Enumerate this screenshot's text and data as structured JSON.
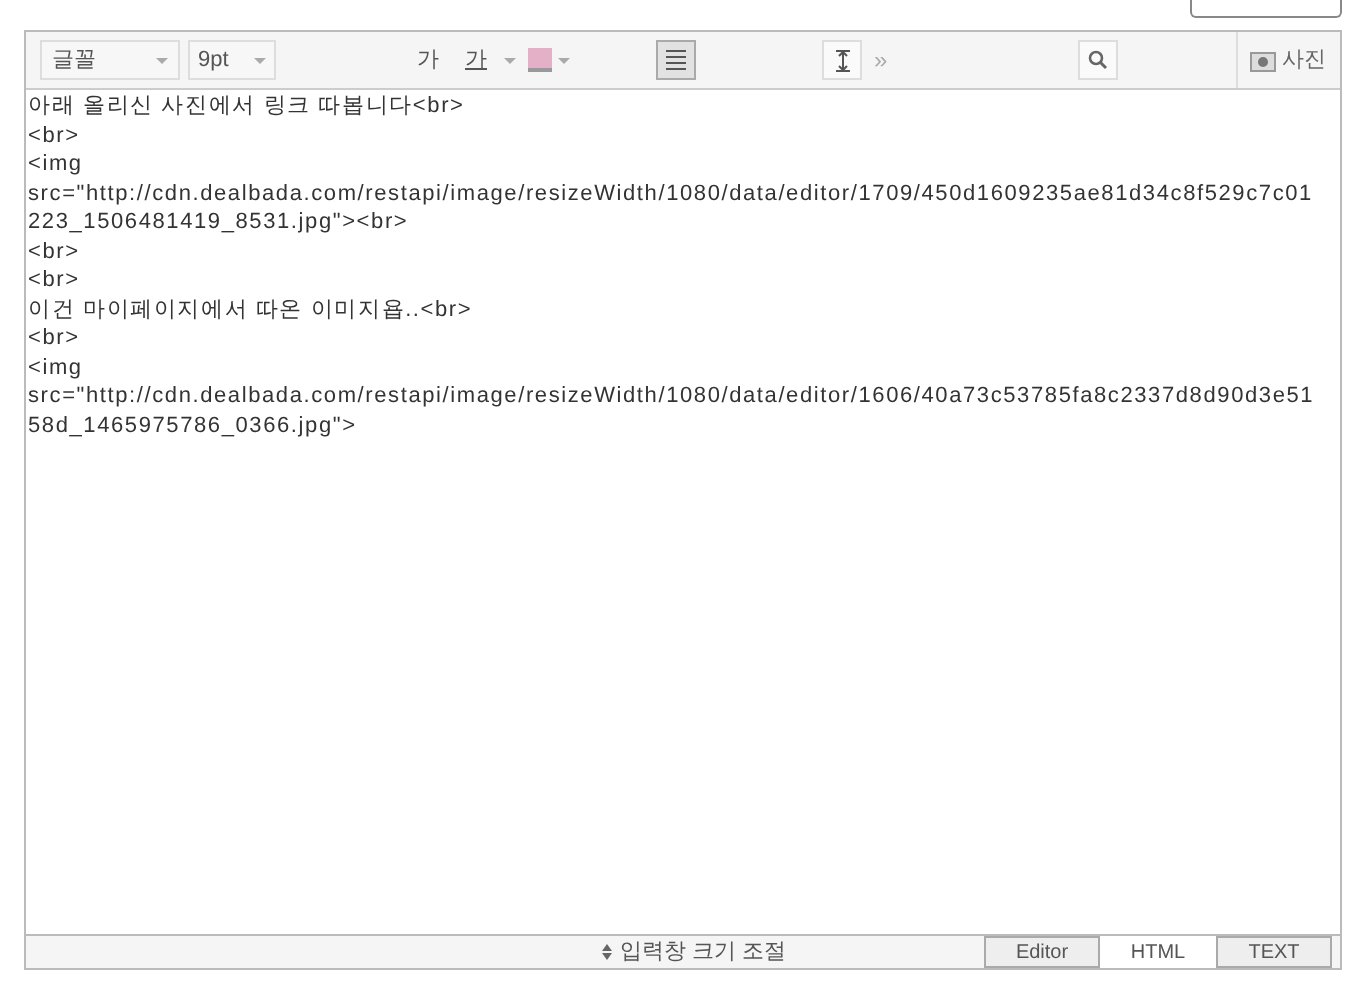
{
  "toolbar": {
    "font": "글꼴",
    "size": "9pt",
    "bold": "가",
    "underline": "가",
    "photo": "사진",
    "more": "»"
  },
  "lines": [
    "아래 올리신 사진에서 링크 따봅니다<br>",
    "<br>",
    "<img",
    "src=\"http://cdn.dealbada.com/restapi/image/resizeWidth/1080/data/editor/1709/450d1609235ae81d34c8f529c7c01",
    "223_1506481419_8531.jpg\"><br>",
    "<br>",
    "<br>",
    "이건 마이페이지에서 따온 이미지욥..<br>",
    "<br>",
    "<img",
    "src=\"http://cdn.dealbada.com/restapi/image/resizeWidth/1080/data/editor/1606/40a73c53785fa8c2337d8d90d3e51",
    "58d_1465975786_0366.jpg\">"
  ],
  "resize": "입력창 크기 조절",
  "tabs": [
    {
      "label": "Editor",
      "selected": false
    },
    {
      "label": "HTML",
      "selected": true
    },
    {
      "label": "TEXT",
      "selected": false
    }
  ]
}
